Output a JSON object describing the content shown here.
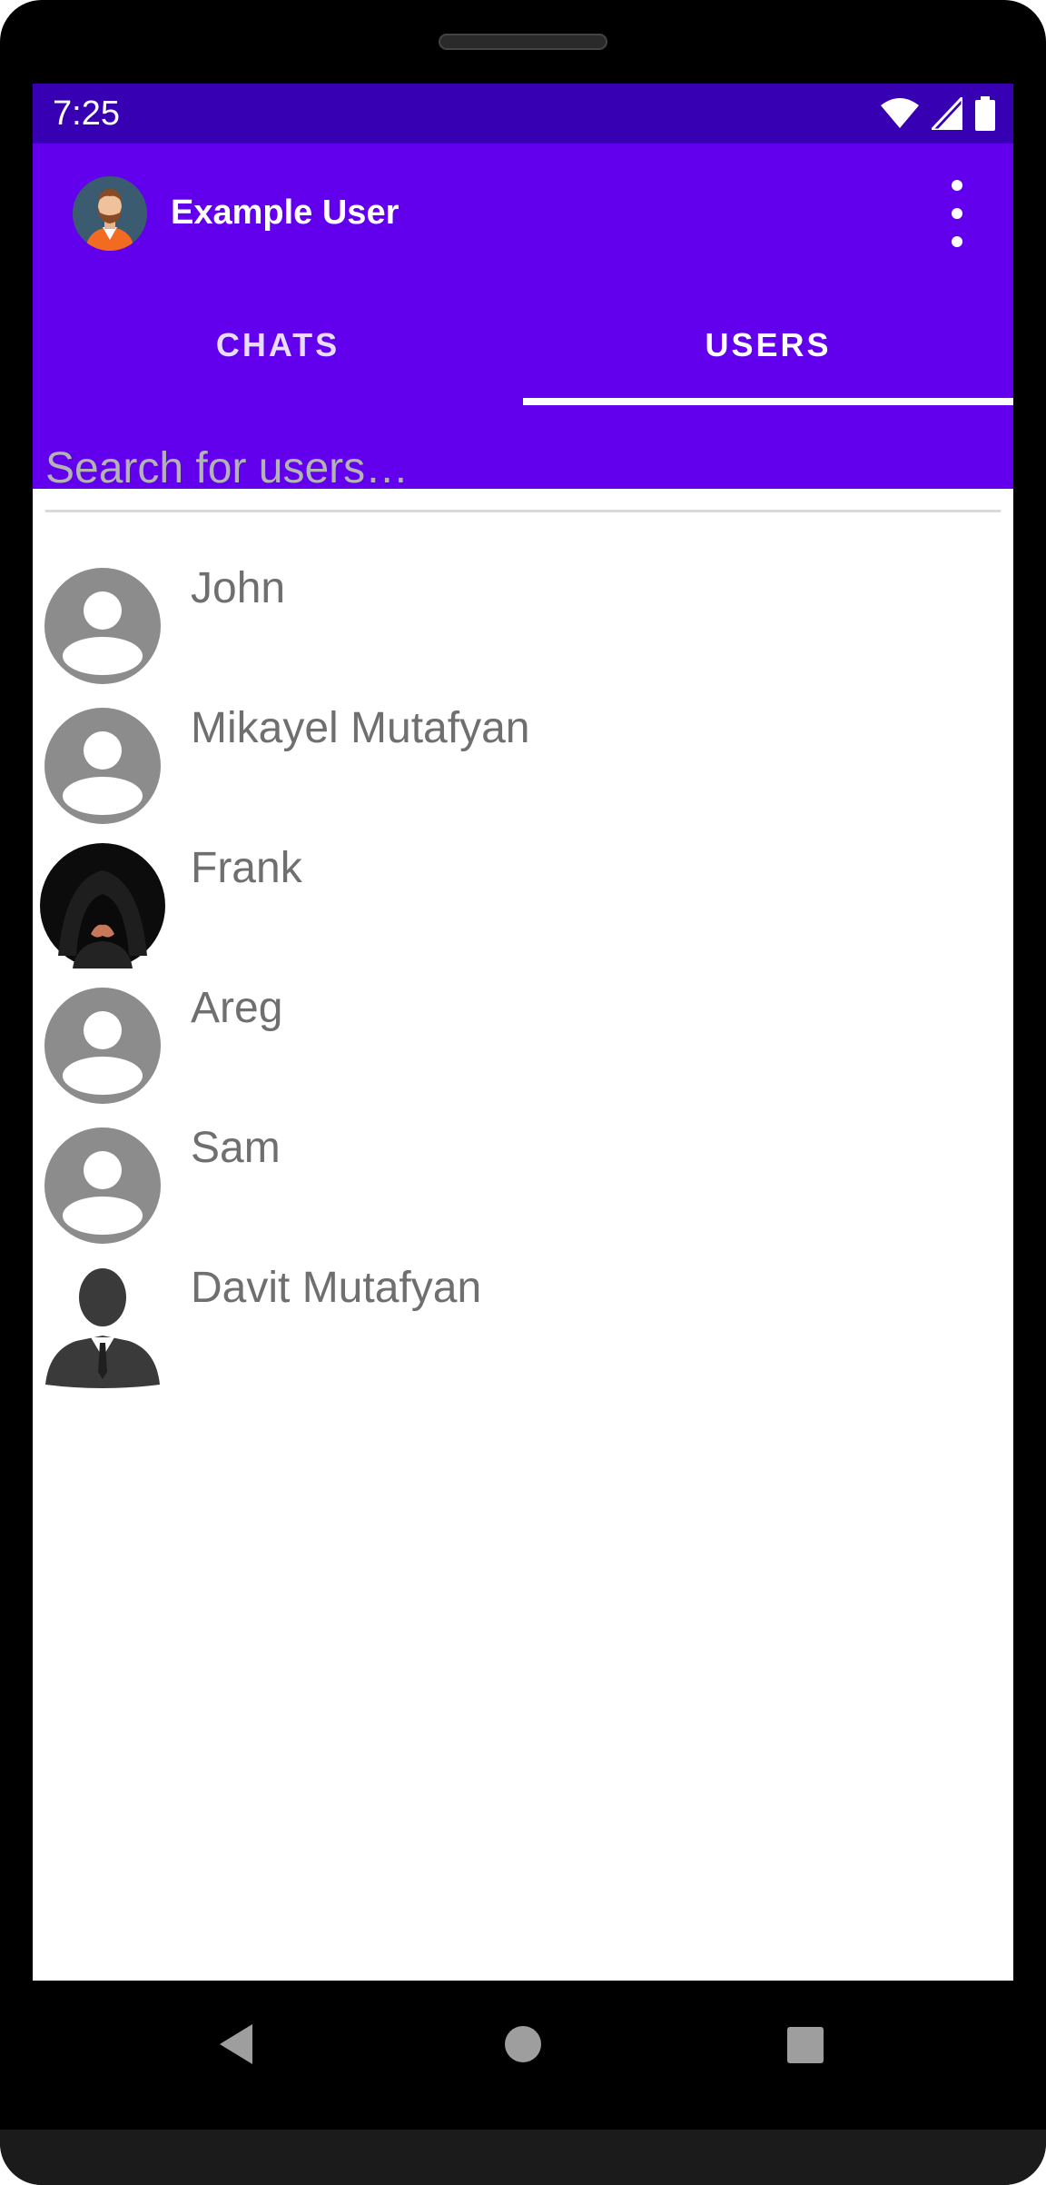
{
  "status_bar": {
    "time": "7:25",
    "icons": [
      "wifi-icon",
      "cell-signal-icon",
      "battery-icon"
    ]
  },
  "app_bar": {
    "title": "Example User",
    "avatar": "user-avatar-icon",
    "menu_icon": "more-vert-icon"
  },
  "tabs": [
    {
      "label": "CHATS",
      "selected": false
    },
    {
      "label": "USERS",
      "selected": true
    }
  ],
  "search": {
    "placeholder": "Search for users…",
    "value": ""
  },
  "users": [
    {
      "name": "John",
      "avatar": "default-avatar-icon"
    },
    {
      "name": "Mikayel Mutafyan",
      "avatar": "default-avatar-icon"
    },
    {
      "name": "Frank",
      "avatar": "hooded-person-photo"
    },
    {
      "name": "Areg",
      "avatar": "default-avatar-icon"
    },
    {
      "name": "Sam",
      "avatar": "default-avatar-icon"
    },
    {
      "name": "Davit Mutafyan",
      "avatar": "businessman-silhouette-icon"
    }
  ],
  "nav_bar": {
    "buttons": [
      "back-triangle-icon",
      "home-circle-icon",
      "recents-square-icon"
    ]
  },
  "colors": {
    "status_bar": "#3700b3",
    "primary": "#6200ee",
    "tab_indicator": "#ffffff",
    "user_name": "#6f6f6f",
    "placeholder": "#b3b3b3",
    "default_avatar": "#8c8c8c"
  }
}
